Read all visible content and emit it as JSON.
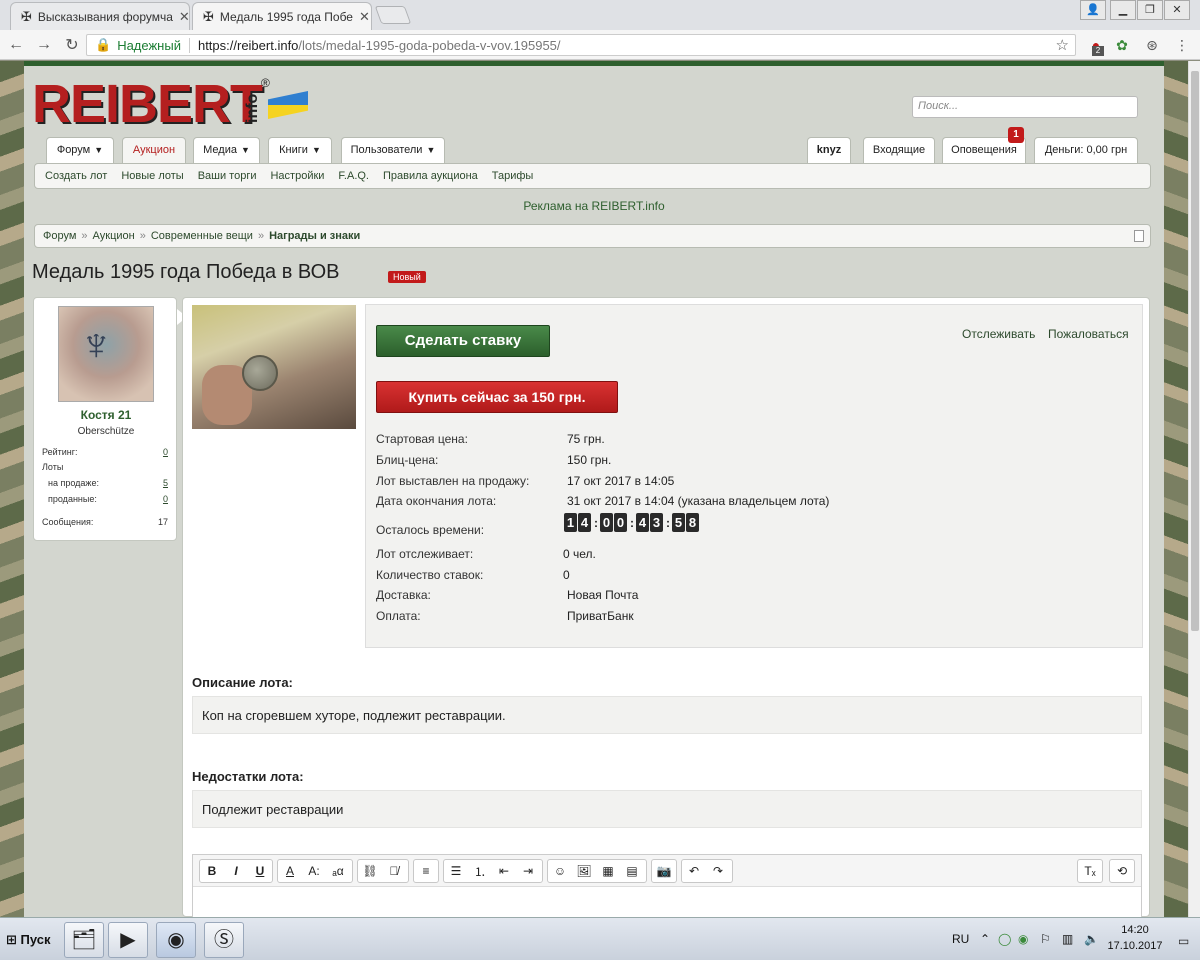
{
  "browser": {
    "tabs": [
      {
        "title": "Высказывания форумча",
        "active": false
      },
      {
        "title": "Медаль 1995 года Побе",
        "active": true
      }
    ],
    "url": {
      "secure_label": "Надежный",
      "host": "https://reibert.info",
      "path": "/lots/medal-1995-goda-pobeda-v-vov.195955/"
    },
    "extension_badge": "2"
  },
  "site": {
    "logo": "REIBERT",
    "logo_suffix": "info",
    "logo_reg": "®",
    "search_placeholder": "Поиск...",
    "main_tabs": [
      "Форум",
      "Аукцион",
      "Медиа",
      "Книги",
      "Пользователи"
    ],
    "user_tabs": [
      "knyz",
      "Входящие",
      "Оповещения",
      "Деньги: 0,00 грн"
    ],
    "notifications_count": "1",
    "subnav": [
      "Создать лот",
      "Новые лоты",
      "Ваши торги",
      "Настройки",
      "F.A.Q.",
      "Правила аукциона",
      "Тарифы"
    ],
    "ad": "Реклама на REIBERT.info",
    "breadcrumb": [
      "Форум",
      "Аукцион",
      "Современные вещи",
      "Награды и знаки"
    ]
  },
  "lot": {
    "title": "Медаль 1995 года Победа в ВОВ",
    "badge": "Новый",
    "bid_button": "Сделать ставку",
    "buy_button": "Купить сейчас за 150 грн.",
    "watch_link": "Отслеживать",
    "report_link": "Пожаловаться",
    "fields": [
      {
        "label": "Стартовая цена:",
        "value": "75 грн."
      },
      {
        "label": "Блиц-цена:",
        "value": "150 грн."
      },
      {
        "label": "Лот выставлен на продажу:",
        "value": "17 окт 2017 в 14:05"
      },
      {
        "label": "Дата окончания лота:",
        "value": "31 окт 2017 в 14:04 (указана владельцем лота)"
      },
      {
        "label": "Осталось времени:",
        "value": ""
      },
      {
        "label": "Лот отслеживает:",
        "value": "0 чел."
      },
      {
        "label": "Количество ставок:",
        "value": "0"
      },
      {
        "label": "Доставка:",
        "value": "Новая Почта"
      },
      {
        "label": "Оплата:",
        "value": "ПриватБанк"
      }
    ],
    "timer": [
      "14",
      "00",
      "43",
      "58"
    ],
    "description_heading": "Описание лота:",
    "description": "Коп на сгоревшем хуторе, подлежит реставрации.",
    "flaws_heading": "Недостатки лота:",
    "flaws": "Подлежит реставрации"
  },
  "seller": {
    "name": "Костя 21",
    "rank": "Oberschütze",
    "stats": [
      {
        "label": "Рейтинг:",
        "value": "0"
      },
      {
        "label": "Лоты",
        "value": ""
      },
      {
        "label": "на продаже:",
        "value": "5"
      },
      {
        "label": "проданные:",
        "value": "0"
      },
      {
        "label": "Сообщения:",
        "value": "17"
      }
    ]
  },
  "taskbar": {
    "start": "Пуск",
    "lang": "RU",
    "time": "14:20",
    "date": "17.10.2017"
  },
  "colors": {
    "brand_green": "#2e5f2e",
    "brand_red": "#b41f1f"
  }
}
